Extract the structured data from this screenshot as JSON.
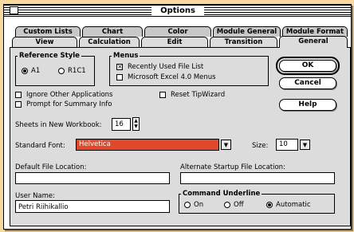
{
  "window": {
    "title": "Options"
  },
  "tabs_back": [
    "Custom Lists",
    "Chart",
    "Color",
    "Module General",
    "Module Format"
  ],
  "tabs_front": [
    "View",
    "Calculation",
    "Edit",
    "Transition",
    "General"
  ],
  "buttons": {
    "ok": "OK",
    "cancel": "Cancel",
    "help": "Help"
  },
  "reference_style": {
    "title": "Reference Style",
    "a1": "A1",
    "r1c1": "R1C1",
    "selected": "A1"
  },
  "menus": {
    "title": "Menus",
    "recent_files": "Recently Used File List",
    "excel4": "Microsoft Excel 4.0 Menus",
    "recent_files_checked": true,
    "excel4_checked": false
  },
  "checks": {
    "ignore_apps": "Ignore Other Applications",
    "prompt_summary": "Prompt for Summary Info",
    "reset_tipwizard": "Reset TipWizard"
  },
  "sheets": {
    "label": "Sheets in New Workbook:",
    "value": "16"
  },
  "font": {
    "label": "Standard Font:",
    "value": "Helvetica",
    "highlight_color": "#e0482a",
    "size_label": "Size:",
    "size_value": "10"
  },
  "default_location": {
    "label": "Default File Location:",
    "value": ""
  },
  "alt_location": {
    "label": "Alternate Startup File Location:",
    "value": ""
  },
  "user_name": {
    "label": "User Name:",
    "value": "Petri Riihikallio"
  },
  "command_underline": {
    "title": "Command Underline",
    "on": "On",
    "off": "Off",
    "automatic": "Automatic",
    "selected": "Automatic"
  }
}
